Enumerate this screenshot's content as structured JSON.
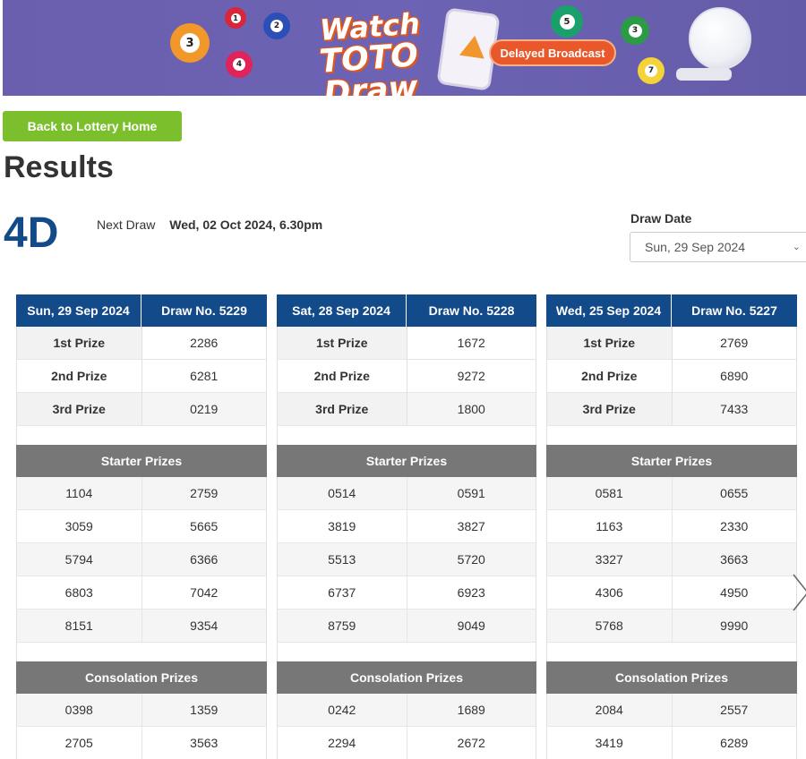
{
  "banner": {
    "title_line1": "Watch",
    "title_line2": "TOTO Draw",
    "broadcast_label": "Delayed Broadcast",
    "balls": [
      "3",
      "4",
      "2",
      "1",
      "5",
      "3",
      "7"
    ],
    "colors": {
      "background": "#6a5fae",
      "accent": "#e8582a"
    }
  },
  "back_button": "Back to Lottery Home",
  "page_title": "Results",
  "logo": "4D",
  "next_draw": {
    "label": "Next Draw",
    "value": "Wed, 02 Oct 2024, 6.30pm"
  },
  "draw_date": {
    "label": "Draw Date",
    "selected": "Sun, 29 Sep 2024"
  },
  "section_labels": {
    "starter": "Starter Prizes",
    "consolation": "Consolation Prizes"
  },
  "draws": [
    {
      "date": "Sun, 29 Sep 2024",
      "draw_no": "Draw No. 5229",
      "prizes": [
        {
          "name": "1st Prize",
          "value": "2286"
        },
        {
          "name": "2nd Prize",
          "value": "6281"
        },
        {
          "name": "3rd Prize",
          "value": "0219"
        }
      ],
      "starter": [
        [
          "1104",
          "2759"
        ],
        [
          "3059",
          "5665"
        ],
        [
          "5794",
          "6366"
        ],
        [
          "6803",
          "7042"
        ],
        [
          "8151",
          "9354"
        ]
      ],
      "consolation": [
        [
          "0398",
          "1359"
        ],
        [
          "2705",
          "3563"
        ]
      ]
    },
    {
      "date": "Sat, 28 Sep 2024",
      "draw_no": "Draw No. 5228",
      "prizes": [
        {
          "name": "1st Prize",
          "value": "1672"
        },
        {
          "name": "2nd Prize",
          "value": "9272"
        },
        {
          "name": "3rd Prize",
          "value": "1800"
        }
      ],
      "starter": [
        [
          "0514",
          "0591"
        ],
        [
          "3819",
          "3827"
        ],
        [
          "5513",
          "5720"
        ],
        [
          "6737",
          "6923"
        ],
        [
          "8759",
          "9049"
        ]
      ],
      "consolation": [
        [
          "0242",
          "1689"
        ],
        [
          "2294",
          "2672"
        ]
      ]
    },
    {
      "date": "Wed, 25 Sep 2024",
      "draw_no": "Draw No. 5227",
      "prizes": [
        {
          "name": "1st Prize",
          "value": "2769"
        },
        {
          "name": "2nd Prize",
          "value": "6890"
        },
        {
          "name": "3rd Prize",
          "value": "7433"
        }
      ],
      "starter": [
        [
          "0581",
          "0655"
        ],
        [
          "1163",
          "2330"
        ],
        [
          "3327",
          "3663"
        ],
        [
          "4306",
          "4950"
        ],
        [
          "5768",
          "9990"
        ]
      ],
      "consolation": [
        [
          "2084",
          "2557"
        ],
        [
          "3419",
          "6289"
        ]
      ]
    }
  ]
}
